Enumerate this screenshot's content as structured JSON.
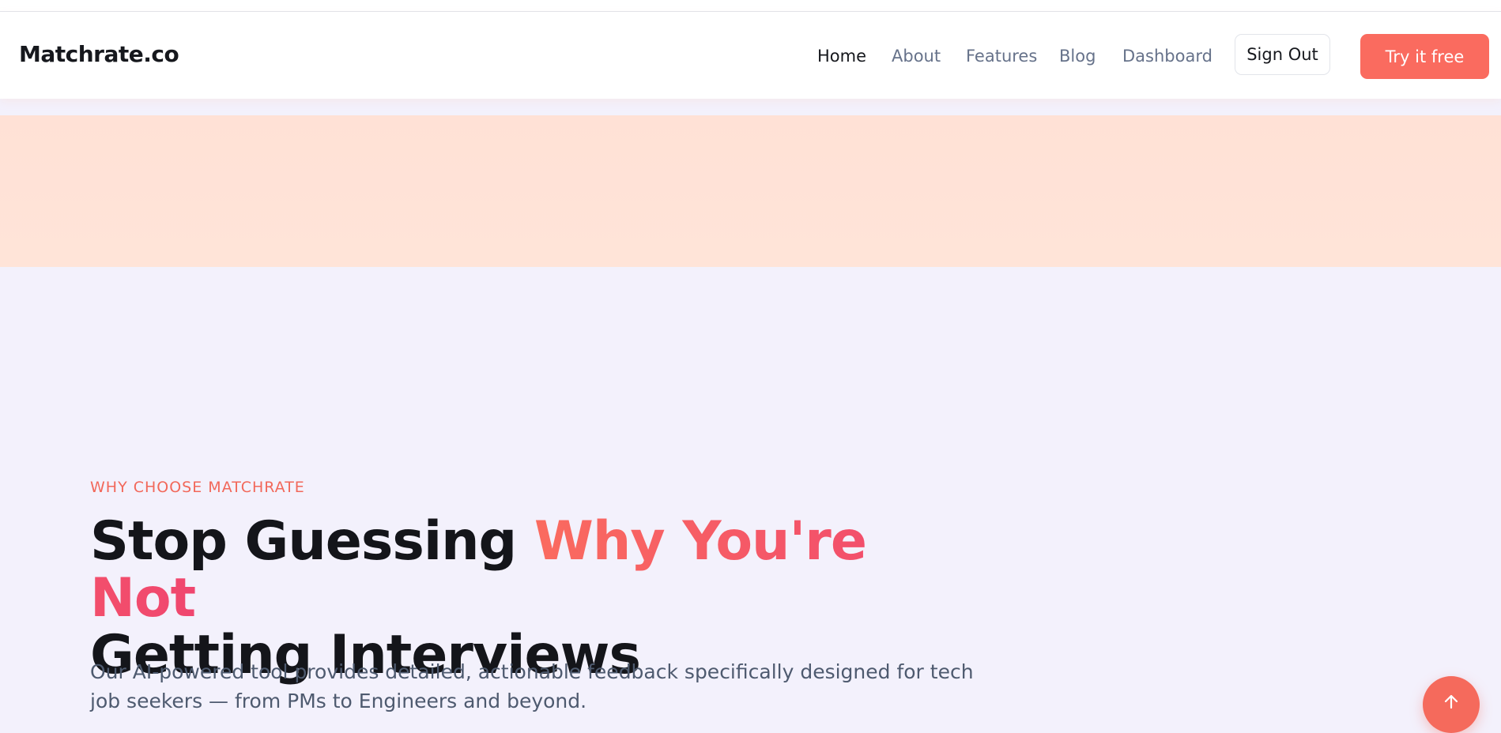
{
  "header": {
    "logo": "Matchrate.co",
    "nav": {
      "home": "Home",
      "about": "About",
      "features": "Features",
      "blog": "Blog",
      "dashboard": "Dashboard"
    },
    "sign_out": "Sign Out",
    "try_free": "Try it free"
  },
  "hero": {
    "eyebrow": "WHY CHOOSE MATCHRATE",
    "headline_plain": "Stop Guessing ",
    "headline_accent": "Why You're Not",
    "headline_line2": "Getting Interviews",
    "subtext": "Our AI-powered tool provides detailed, actionable feedback specifically designed for tech job seekers — from PMs to Engineers and beyond."
  },
  "colors": {
    "accent": "#fa6b5f",
    "accent_gradient_end": "#f0466f",
    "banner": "#ffe2d6",
    "section_bg": "#f3f1fc"
  },
  "icons": {
    "scroll_top": "arrow-up-icon"
  }
}
